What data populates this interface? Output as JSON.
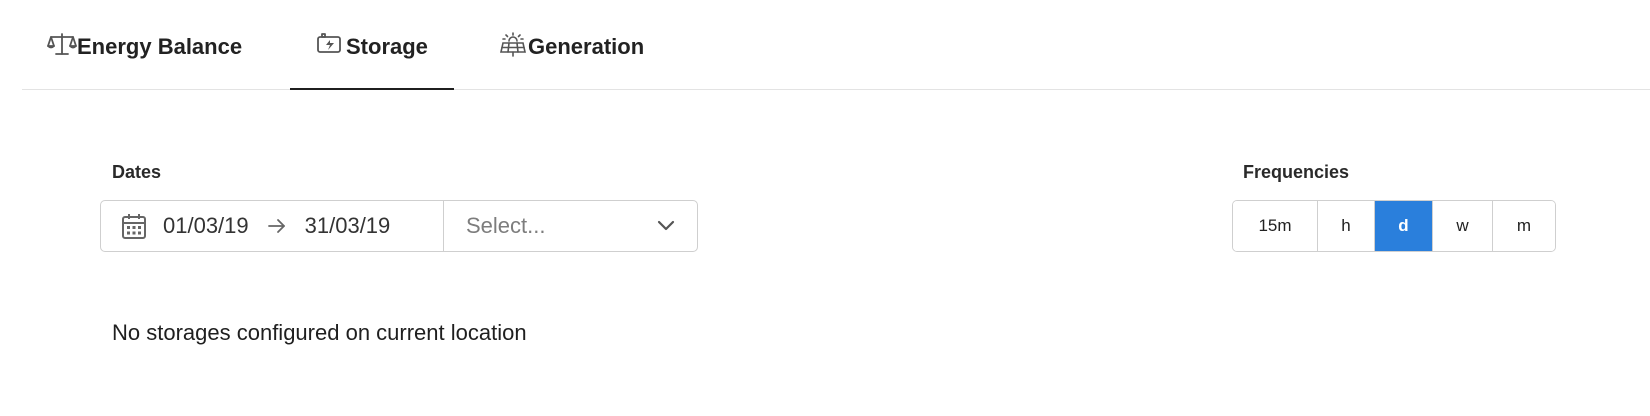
{
  "tabs": [
    {
      "label": "Energy Balance",
      "icon": "balance-scale-icon",
      "active": false
    },
    {
      "label": "Storage",
      "icon": "battery-icon",
      "active": true
    },
    {
      "label": "Generation",
      "icon": "solar-panel-icon",
      "active": false
    }
  ],
  "dates": {
    "label": "Dates",
    "start": "01/03/19",
    "end": "31/03/19",
    "select_placeholder": "Select..."
  },
  "frequencies": {
    "label": "Frequencies",
    "options": [
      "15m",
      "h",
      "d",
      "w",
      "m"
    ],
    "selected": "d"
  },
  "message": "No storages configured on current location",
  "colors": {
    "accent": "#2a7fdc",
    "border": "#cfcfcf",
    "text": "#1f1f1f"
  }
}
